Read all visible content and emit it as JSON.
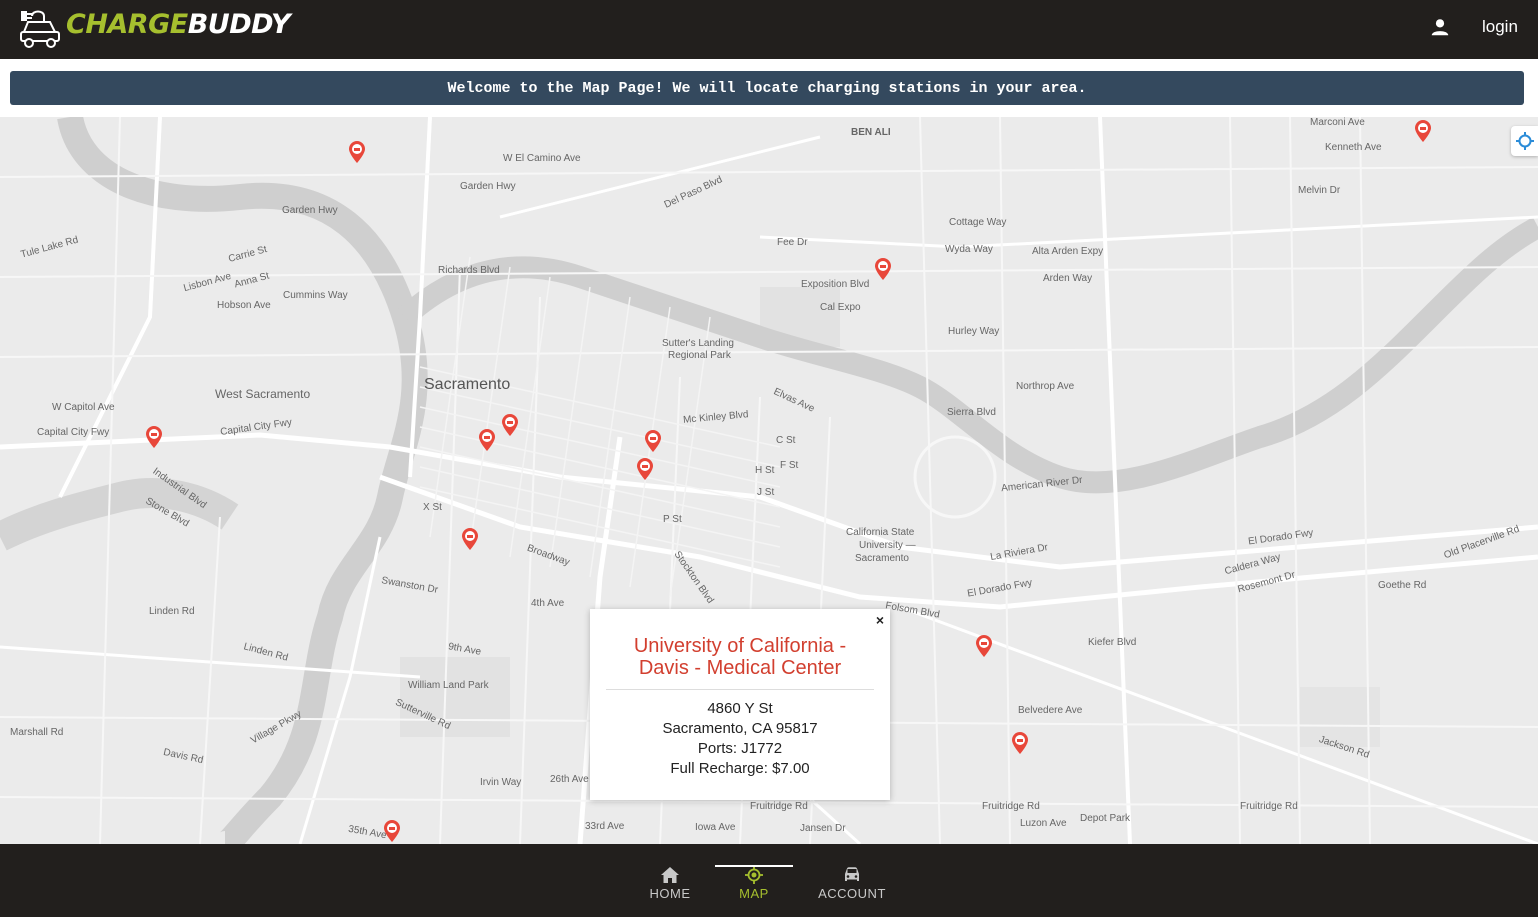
{
  "header": {
    "brand_part1": "CHARGE",
    "brand_part2": "BUDDY",
    "login_label": "login",
    "brand_color": "#a6bf2e"
  },
  "banner": {
    "text": "Welcome to the Map Page! We will locate charging stations in your area."
  },
  "map": {
    "labels": {
      "city": "Sacramento",
      "west_sac": "West Sacramento",
      "sutters": "Sutter's Landing",
      "sutters2": "Regional Park",
      "cal_expo": "Cal Expo",
      "exposition": "Exposition Blvd",
      "csu1": "California State",
      "csu2": "University —",
      "csu3": "Sacramento",
      "william_land": "William Land Park",
      "ben_ali": "BEN ALI",
      "garden_hwy": "Garden Hwy",
      "w_el_camino": "W El Camino Ave",
      "del_paso": "Del Paso Blvd",
      "arden_way": "Arden Way",
      "fee_dr": "Fee Dr",
      "cottage_way": "Cottage Way",
      "alta_arden": "Alta Arden Expy",
      "hurley": "Hurley Way",
      "northrop": "Northrop Ave",
      "sierra_blvd": "Sierra Blvd",
      "american_river": "American River Dr",
      "la_riviera": "La Riviera Dr",
      "el_dorado_fwy": "El Dorado Fwy",
      "folsom": "Folsom Blvd",
      "kiefer": "Kiefer Blvd",
      "belvedere": "Belvedere Ave",
      "fruitridge": "Fruitridge Rd",
      "jackson": "Jackson Rd",
      "capitol_city": "Capital City Fwy",
      "w_capitol": "W Capitol Ave",
      "industrial": "Industrial Blvd",
      "stone": "Stone Blvd",
      "linden": "Linden Rd",
      "swanston": "Swanston Dr",
      "marshall": "Marshall Rd",
      "davis_rd": "Davis Rd",
      "irvin_way": "Irvin Way",
      "broadway": "Broadway",
      "x_st": "X St",
      "p_st": "P St",
      "j_st": "J St",
      "h_st": "H St",
      "c_st": "C St",
      "f_st": "F St",
      "cummins": "Cummins Way",
      "hobson": "Hobson Ave",
      "richards": "Richards Blvd",
      "marconi": "Marconi Ave",
      "kenneth": "Kenneth Ave",
      "melvin": "Melvin Dr",
      "wyda": "Wyda Way",
      "el_dorado_fwy2": "El Dorado Fwy",
      "goethe": "Goethe Rd",
      "old_placerville": "Old Placerville Rd",
      "depot_park": "Depot Park",
      "luzon": "Luzon Ave",
      "jansen": "Jansen Dr",
      "iowa": "Iowa Ave",
      "ave_33rd": "33rd Ave",
      "ave_35th": "35th Ave",
      "ave_26th": "26th Ave",
      "ave_9th": "9th Ave",
      "ave_4th": "4th Ave",
      "elvas": "Elvas Ave",
      "mckinley": "Mc Kinley Blvd",
      "stockton": "Stockton Blvd",
      "tule_lake": "Tule Lake Rd",
      "carrie": "Carrie St",
      "anna": "Anna St",
      "lisbon": "Lisbon Ave",
      "village": "Village Pkwy",
      "sutterville": "Sutterville Rd",
      "rosemont": "Rosemont Dr",
      "caldera": "Caldera Way"
    }
  },
  "popup": {
    "close_label": "×",
    "title_line1": "University of California -",
    "title_line2": "Davis - Medical Center",
    "address": "4860 Y St",
    "city_state_zip": "Sacramento, CA 95817",
    "ports": "Ports: J1772",
    "price": "Full Recharge: $7.00",
    "title_color": "#d23f2f"
  },
  "nav": {
    "home_label": "HOME",
    "map_label": "MAP",
    "account_label": "ACCOUNT",
    "active_tab": "MAP"
  }
}
